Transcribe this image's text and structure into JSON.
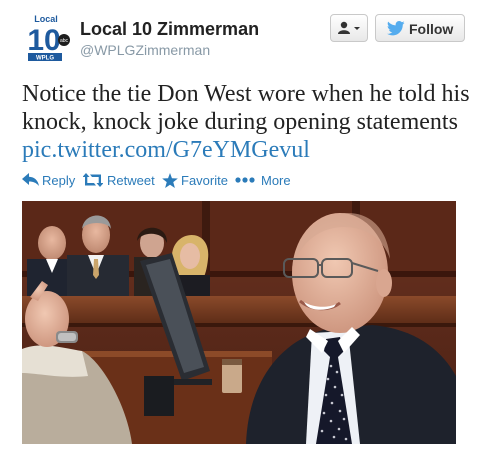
{
  "account": {
    "full_name": "Local 10 Zimmerman",
    "screen_name": "@WPLGZimmerman",
    "logo": {
      "top_text": "Local",
      "number": "10",
      "bottom_text": "WPLG",
      "badge": "abc"
    }
  },
  "buttons": {
    "follow_label": "Follow",
    "user_menu_icon": "user-dropdown-icon"
  },
  "tweet": {
    "text": "Notice the tie Don West wore when he told his knock, knock joke during opening statements ",
    "link": "pic.twitter.com/G7eYMGevul"
  },
  "actions": [
    {
      "label": "Reply",
      "icon": "reply-icon"
    },
    {
      "label": "Retweet",
      "icon": "retweet-icon"
    },
    {
      "label": "Favorite",
      "icon": "star-icon"
    },
    {
      "label": "More",
      "icon": "more-dots-icon"
    }
  ],
  "colors": {
    "link": "#2b7bb9",
    "follow_bird": "#55acee",
    "logo_blue": "#1e5a9e"
  }
}
